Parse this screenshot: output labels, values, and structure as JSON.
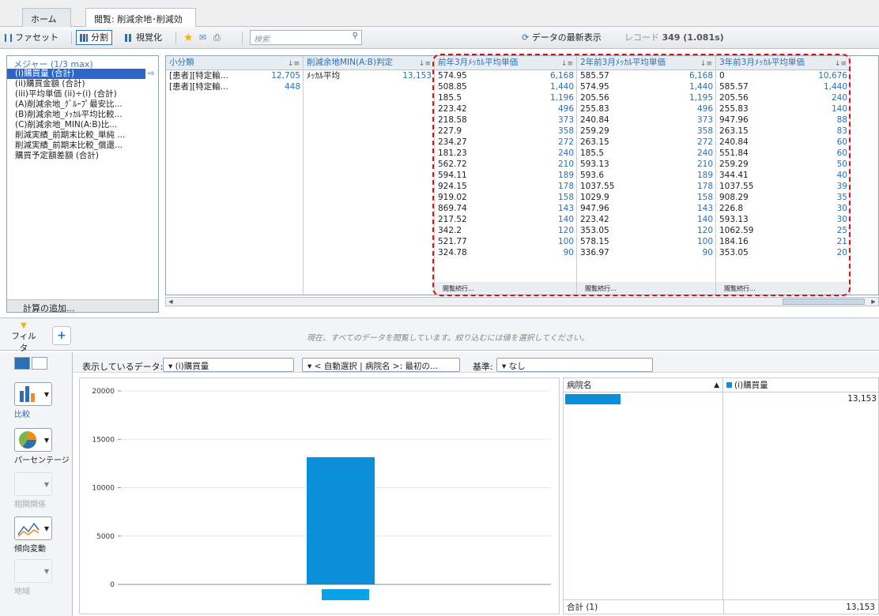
{
  "tabs": {
    "home": "ホーム",
    "active": "閲覧: 削減余地･削減効果"
  },
  "toolbar": {
    "facet": "ファセット",
    "split": "分割",
    "visualize": "視覚化",
    "search_placeholder": "検索",
    "refresh": "データの最新表示",
    "record_label": "レコード",
    "record_count": "349 (1.081s)"
  },
  "measures": {
    "header": "メジャー (1/3 max)",
    "items": [
      "(i)購買量 (合計)",
      "(ii)購買金額 (合計)",
      "(iii)平均単価 (ii)÷(i) (合計)",
      "(A)削減余地_ｸﾞﾙｰﾌﾟ最安比...",
      "(B)削減余地_ﾒｯｶﾙ平均比較...",
      "(C)削減余地_MIN(A:B)比...",
      "削減実績_前期末比較_単純 ...",
      "削減実績_前期末比較_償還...",
      "購買予定額差額 (合計)"
    ],
    "add_calc": "計算の追加..."
  },
  "grid": {
    "col1": {
      "header": "小分類",
      "rows": [
        {
          "label": "[患者][特定輸...",
          "value": "12,705"
        },
        {
          "label": "[患者][特定輸...",
          "value": "448"
        }
      ]
    },
    "col2": {
      "header": "削減余地MIN(A:B)判定",
      "rows": [
        {
          "label": "ﾒｯｶﾙ平均",
          "value": "13,153"
        }
      ]
    },
    "col3": {
      "header": "前年3月ﾒｯｶﾙ平均単価",
      "rows": [
        {
          "label": "574.95",
          "value": "6,168"
        },
        {
          "label": "508.85",
          "value": "1,440"
        },
        {
          "label": "185.5",
          "value": "1,196"
        },
        {
          "label": "223.42",
          "value": "496"
        },
        {
          "label": "218.58",
          "value": "373"
        },
        {
          "label": "227.9",
          "value": "358"
        },
        {
          "label": "234.27",
          "value": "272"
        },
        {
          "label": "181.23",
          "value": "240"
        },
        {
          "label": "562.72",
          "value": "210"
        },
        {
          "label": "594.11",
          "value": "189"
        },
        {
          "label": "924.15",
          "value": "178"
        },
        {
          "label": "919.02",
          "value": "158"
        },
        {
          "label": "869.74",
          "value": "143"
        },
        {
          "label": "217.52",
          "value": "140"
        },
        {
          "label": "342.2",
          "value": "120"
        },
        {
          "label": "521.77",
          "value": "100"
        },
        {
          "label": "324.78",
          "value": "90"
        }
      ],
      "footer": "閲覧続行..."
    },
    "col4": {
      "header": "2年前3月ﾒｯｶﾙ平均単価",
      "rows": [
        {
          "label": "585.57",
          "value": "6,168"
        },
        {
          "label": "574.95",
          "value": "1,440"
        },
        {
          "label": "205.56",
          "value": "1,195"
        },
        {
          "label": "255.83",
          "value": "496"
        },
        {
          "label": "240.84",
          "value": "373"
        },
        {
          "label": "259.29",
          "value": "358"
        },
        {
          "label": "263.15",
          "value": "272"
        },
        {
          "label": "185.5",
          "value": "240"
        },
        {
          "label": "593.13",
          "value": "210"
        },
        {
          "label": "593.6",
          "value": "189"
        },
        {
          "label": "1037.55",
          "value": "178"
        },
        {
          "label": "1029.9",
          "value": "158"
        },
        {
          "label": "947.96",
          "value": "143"
        },
        {
          "label": "223.42",
          "value": "140"
        },
        {
          "label": "353.05",
          "value": "120"
        },
        {
          "label": "578.15",
          "value": "100"
        },
        {
          "label": "336.97",
          "value": "90"
        }
      ],
      "footer": "閲覧続行..."
    },
    "col5": {
      "header": "3年前3月ﾒｯｶﾙ平均単価",
      "rows": [
        {
          "label": "0",
          "value": "10,676"
        },
        {
          "label": "585.57",
          "value": "1,440"
        },
        {
          "label": "205.56",
          "value": "240"
        },
        {
          "label": "255.83",
          "value": "140"
        },
        {
          "label": "947.96",
          "value": "88"
        },
        {
          "label": "263.15",
          "value": "83"
        },
        {
          "label": "240.84",
          "value": "60"
        },
        {
          "label": "551.84",
          "value": "60"
        },
        {
          "label": "259.29",
          "value": "50"
        },
        {
          "label": "344.41",
          "value": "40"
        },
        {
          "label": "1037.55",
          "value": "39"
        },
        {
          "label": "908.29",
          "value": "35"
        },
        {
          "label": "226.8",
          "value": "30"
        },
        {
          "label": "593.13",
          "value": "30"
        },
        {
          "label": "1062.59",
          "value": "25"
        },
        {
          "label": "184.16",
          "value": "21"
        },
        {
          "label": "353.05",
          "value": "20"
        }
      ],
      "footer": "閲覧続行..."
    }
  },
  "filter": {
    "label": "フィルタ",
    "message": "現在、すべてのデータを閲覧しています。絞り込むには値を選択してください。"
  },
  "chart_tools": [
    "比較",
    "パーセンテージ",
    "相関関係",
    "傾向変動",
    "地域"
  ],
  "chart_header": {
    "shown_data_label": "表示しているデータ:",
    "shown_data_value": "(i)購買量",
    "auto_select": "< 自動選択 | 病院名 >: 最初の...",
    "basis_label": "基準:",
    "basis_value": "なし"
  },
  "chart_data": {
    "type": "bar",
    "categories": [
      ""
    ],
    "values": [
      13153
    ],
    "ylim": [
      0,
      20000
    ],
    "yticks": [
      "0",
      "5000",
      "10000",
      "15000",
      "20000"
    ],
    "bar_color": "#0a8fd8"
  },
  "table": {
    "col_name": "病院名",
    "col_measure": "(i)購買量",
    "row_value": "13,153",
    "total_label": "合計 (1)",
    "total_value": "13,153"
  }
}
